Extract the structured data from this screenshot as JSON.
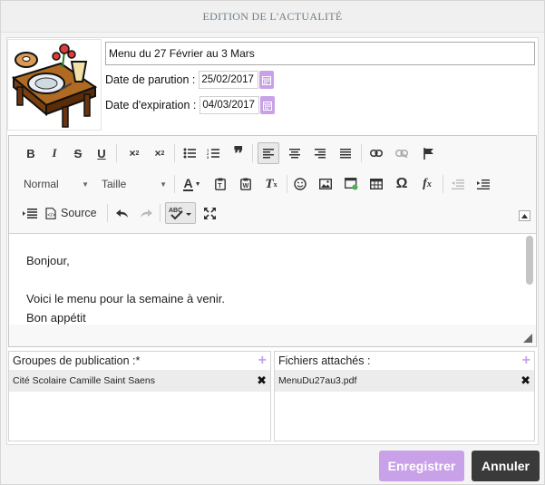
{
  "dialog": {
    "title": "EDITION DE L'ACTUALITÉ"
  },
  "article": {
    "title_value": "Menu du 27 Février au 3 Mars",
    "publish_label": "Date de parution :",
    "publish_value": "25/02/2017",
    "expire_label": "Date d'expiration :",
    "expire_value": "04/03/2017"
  },
  "toolbar": {
    "format_label": "Normal",
    "size_label": "Taille",
    "source_label": "Source",
    "icons": [
      "bold-icon",
      "italic-icon",
      "strikethrough-icon",
      "underline-icon",
      "subscript-icon",
      "superscript-icon",
      "bulleted-list-icon",
      "numbered-list-icon",
      "blockquote-icon",
      "align-left-icon",
      "align-center-icon",
      "align-right-icon",
      "justify-icon",
      "link-icon",
      "unlink-icon",
      "flag-icon",
      "text-color-icon",
      "paste-text-icon",
      "paste-word-icon",
      "remove-format-icon",
      "smiley-icon",
      "image-icon",
      "new-window-icon",
      "table-icon",
      "omega-icon",
      "fx-icon",
      "outdent-icon",
      "indent-icon",
      "show-blocks-icon",
      "source-icon",
      "undo-icon",
      "redo-icon",
      "spellcheck-icon",
      "maximize-icon"
    ]
  },
  "editor": {
    "lines": [
      "Bonjour,",
      "",
      "Voici le menu pour la semaine à venir.",
      "Bon appétit"
    ]
  },
  "groups": {
    "title": "Groupes de publication :*",
    "items": [
      "Cité Scolaire Camille Saint Saens"
    ]
  },
  "files": {
    "title": "Fichiers attachés :",
    "items": [
      "MenuDu27au3.pdf"
    ]
  },
  "actions": {
    "save_label": "Enregistrer",
    "cancel_label": "Annuler"
  },
  "colors": {
    "accent": "#c9a1e8",
    "cancel": "#3a3a3a"
  }
}
